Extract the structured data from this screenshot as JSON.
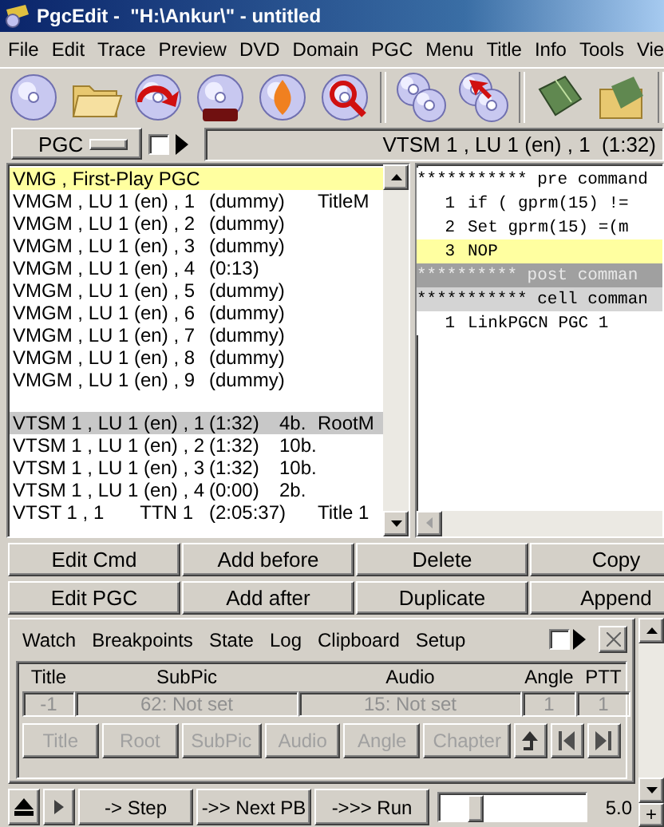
{
  "window": {
    "title": "PgcEdit -  \"H:\\Ankur\\\" - untitled"
  },
  "menu": [
    "File",
    "Edit",
    "Trace",
    "Preview",
    "DVD",
    "Domain",
    "PGC",
    "Menu",
    "Title",
    "Info",
    "Tools",
    "Vie"
  ],
  "selector": {
    "label": "PGC",
    "checked": false,
    "status": "VTSM 1 , LU 1 (en) , 1  (1:32)"
  },
  "pgc_list": {
    "groups": [
      [
        {
          "name": "VMG , First-Play PGC",
          "selected": true,
          "current": false
        },
        {
          "name": "VMGM , LU 1 (en) , 1",
          "time": "(dummy)",
          "menu": "TitleM",
          "selected": false,
          "current": false
        },
        {
          "name": "VMGM , LU 1 (en) , 2",
          "time": "(dummy)",
          "selected": false,
          "current": false
        },
        {
          "name": "VMGM , LU 1 (en) , 3",
          "time": "(dummy)",
          "selected": false,
          "current": false
        },
        {
          "name": "VMGM , LU 1 (en) , 4",
          "time": "(0:13)",
          "selected": false,
          "current": false
        },
        {
          "name": "VMGM , LU 1 (en) , 5",
          "time": "(dummy)",
          "selected": false,
          "current": false
        },
        {
          "name": "VMGM , LU 1 (en) , 6",
          "time": "(dummy)",
          "selected": false,
          "current": false
        },
        {
          "name": "VMGM , LU 1 (en) , 7",
          "time": "(dummy)",
          "selected": false,
          "current": false
        },
        {
          "name": "VMGM , LU 1 (en) , 8",
          "time": "(dummy)",
          "selected": false,
          "current": false
        },
        {
          "name": "VMGM , LU 1 (en) , 9",
          "time": "(dummy)",
          "selected": false,
          "current": false
        }
      ],
      [
        {
          "name": "VTSM 1 , LU 1 (en) , 1",
          "time": "(1:32)",
          "blocks": "4b.",
          "menu": "RootM",
          "selected": false,
          "current": true
        },
        {
          "name": "VTSM 1 , LU 1 (en) , 2",
          "time": "(1:32)",
          "blocks": "10b.",
          "selected": false,
          "current": false
        },
        {
          "name": "VTSM 1 , LU 1 (en) , 3",
          "time": "(1:32)",
          "blocks": "10b.",
          "selected": false,
          "current": false
        },
        {
          "name": "VTSM 1 , LU 1 (en) , 4",
          "time": "(0:00)",
          "blocks": "2b.",
          "selected": false,
          "current": false
        },
        {
          "name": "VTST 1 , 1",
          "title_number": "TTN 1",
          "time": "(2:05:37)",
          "menu": "Title 1",
          "selected": false,
          "current": false
        }
      ]
    ]
  },
  "commands": [
    {
      "kind": "header",
      "text": "*********** pre command",
      "color": "#ffffff",
      "selected": false
    },
    {
      "kind": "command",
      "number": "1",
      "text": "if ( gprm(15) !=",
      "selected": false
    },
    {
      "kind": "command",
      "number": "2",
      "text": "Set gprm(15) =(m",
      "selected": false
    },
    {
      "kind": "command",
      "number": "3",
      "text": "NOP",
      "selected": true
    },
    {
      "kind": "header",
      "text": "********** post comman",
      "color": "#a0a0a0",
      "selected": false
    },
    {
      "kind": "header",
      "text": "*********** cell comman",
      "color": "#d4d4d4",
      "selected": false
    },
    {
      "kind": "command",
      "number": "1",
      "text": "LinkPGCN PGC 1",
      "selected": false
    }
  ],
  "edit_buttons": [
    [
      "Edit Cmd",
      "Add before",
      "Delete",
      "Copy"
    ],
    [
      "Edit PGC",
      "Add after",
      "Duplicate",
      "Append"
    ]
  ],
  "debug": {
    "tabs": [
      "Watch",
      "Breakpoints",
      "State",
      "Log",
      "Clipboard",
      "Setup"
    ],
    "checked": false,
    "columns": [
      "Title",
      "SubPic",
      "Audio",
      "Angle",
      "PTT"
    ],
    "values": [
      "-1",
      "62: Not set",
      "15: Not set",
      "1",
      "1"
    ],
    "nav_buttons": [
      "Title",
      "Root",
      "SubPic",
      "Audio",
      "Angle",
      "Chapter"
    ]
  },
  "playback": {
    "buttons": [
      "-> Step",
      "->> Next PB",
      "->>> Run"
    ],
    "speed": {
      "level": 0.2
    },
    "reading": "5.0",
    "plus": "+"
  }
}
